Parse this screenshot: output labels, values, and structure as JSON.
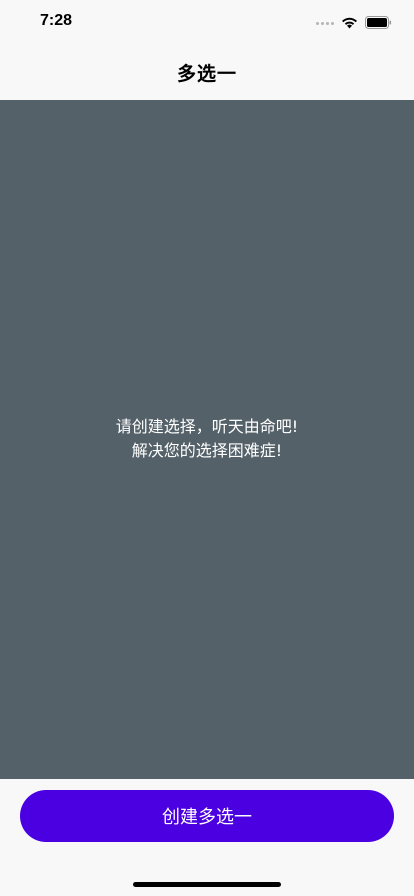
{
  "status_bar": {
    "time": "7:28",
    "icons": [
      "signal-icon",
      "wifi-icon",
      "battery-icon"
    ]
  },
  "nav": {
    "title": "多选一"
  },
  "main": {
    "hint_line1": "请创建选择，听天由命吧!",
    "hint_line2": "解决您的选择困难症!"
  },
  "footer": {
    "create_button_label": "创建多选一"
  },
  "colors": {
    "content_background": "#546168",
    "button_background": "#4a00e0",
    "page_background": "#f8f8f8"
  }
}
